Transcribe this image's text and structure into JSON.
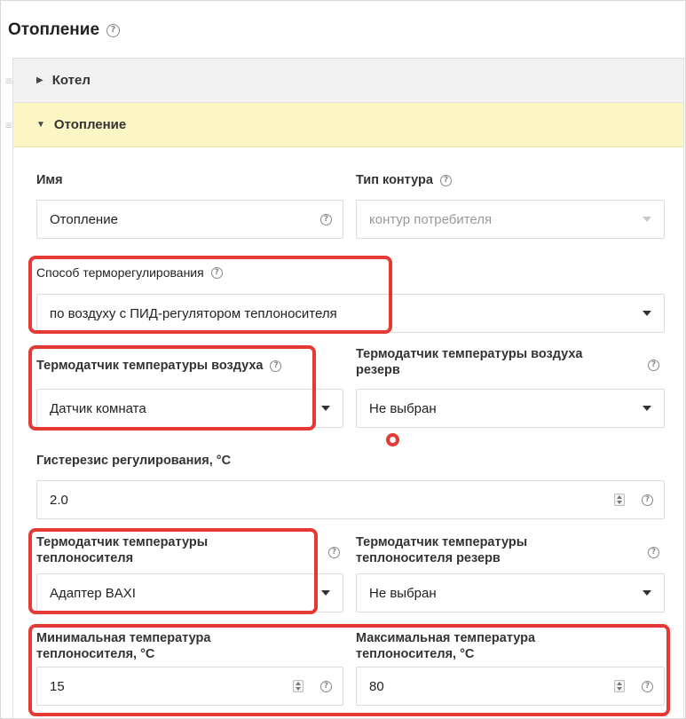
{
  "page": {
    "title": "Отопление"
  },
  "accordion": {
    "sections": [
      {
        "label": "Котел",
        "expanded": false
      },
      {
        "label": "Отопление",
        "expanded": true
      }
    ]
  },
  "form": {
    "name": {
      "label": "Имя",
      "value": "Отопление"
    },
    "circuit_type": {
      "label": "Тип контура",
      "value": "контур потребителя",
      "disabled": true
    },
    "regulation_method": {
      "label": "Способ терморегулирования",
      "value": "по воздуху с ПИД-регулятором теплоносителя"
    },
    "air_sensor": {
      "label": "Термодатчик температуры воздуха",
      "value": "Датчик комната"
    },
    "air_sensor_reserve": {
      "label_line1": "Термодатчик температуры воздуха",
      "label_line2": "резерв",
      "value": "Не выбран"
    },
    "hysteresis": {
      "label": "Гистерезис регулирования, °C",
      "value": "2.0"
    },
    "coolant_sensor": {
      "label_line1": "Термодатчик температуры",
      "label_line2": "теплоносителя",
      "value": "Адаптер BAXI"
    },
    "coolant_sensor_reserve": {
      "label_line1": "Термодатчик температуры",
      "label_line2": "теплоносителя резерв",
      "value": "Не выбран"
    },
    "min_temp": {
      "label_line1": "Минимальная температура",
      "label_line2": "теплоносителя, °C",
      "value": "15"
    },
    "max_temp": {
      "label_line1": "Максимальная температура",
      "label_line2": "теплоносителя, °C",
      "value": "80"
    }
  },
  "icons": {
    "help": "question-circle-icon",
    "caret_collapsed": "triangle-right-icon",
    "caret_expanded": "triangle-down-icon",
    "drag": "drag-handle-icon"
  },
  "colors": {
    "highlight": "#e53935",
    "active_section_bg": "#fbf6c4",
    "collapsed_section_bg": "#f2f2f2"
  }
}
